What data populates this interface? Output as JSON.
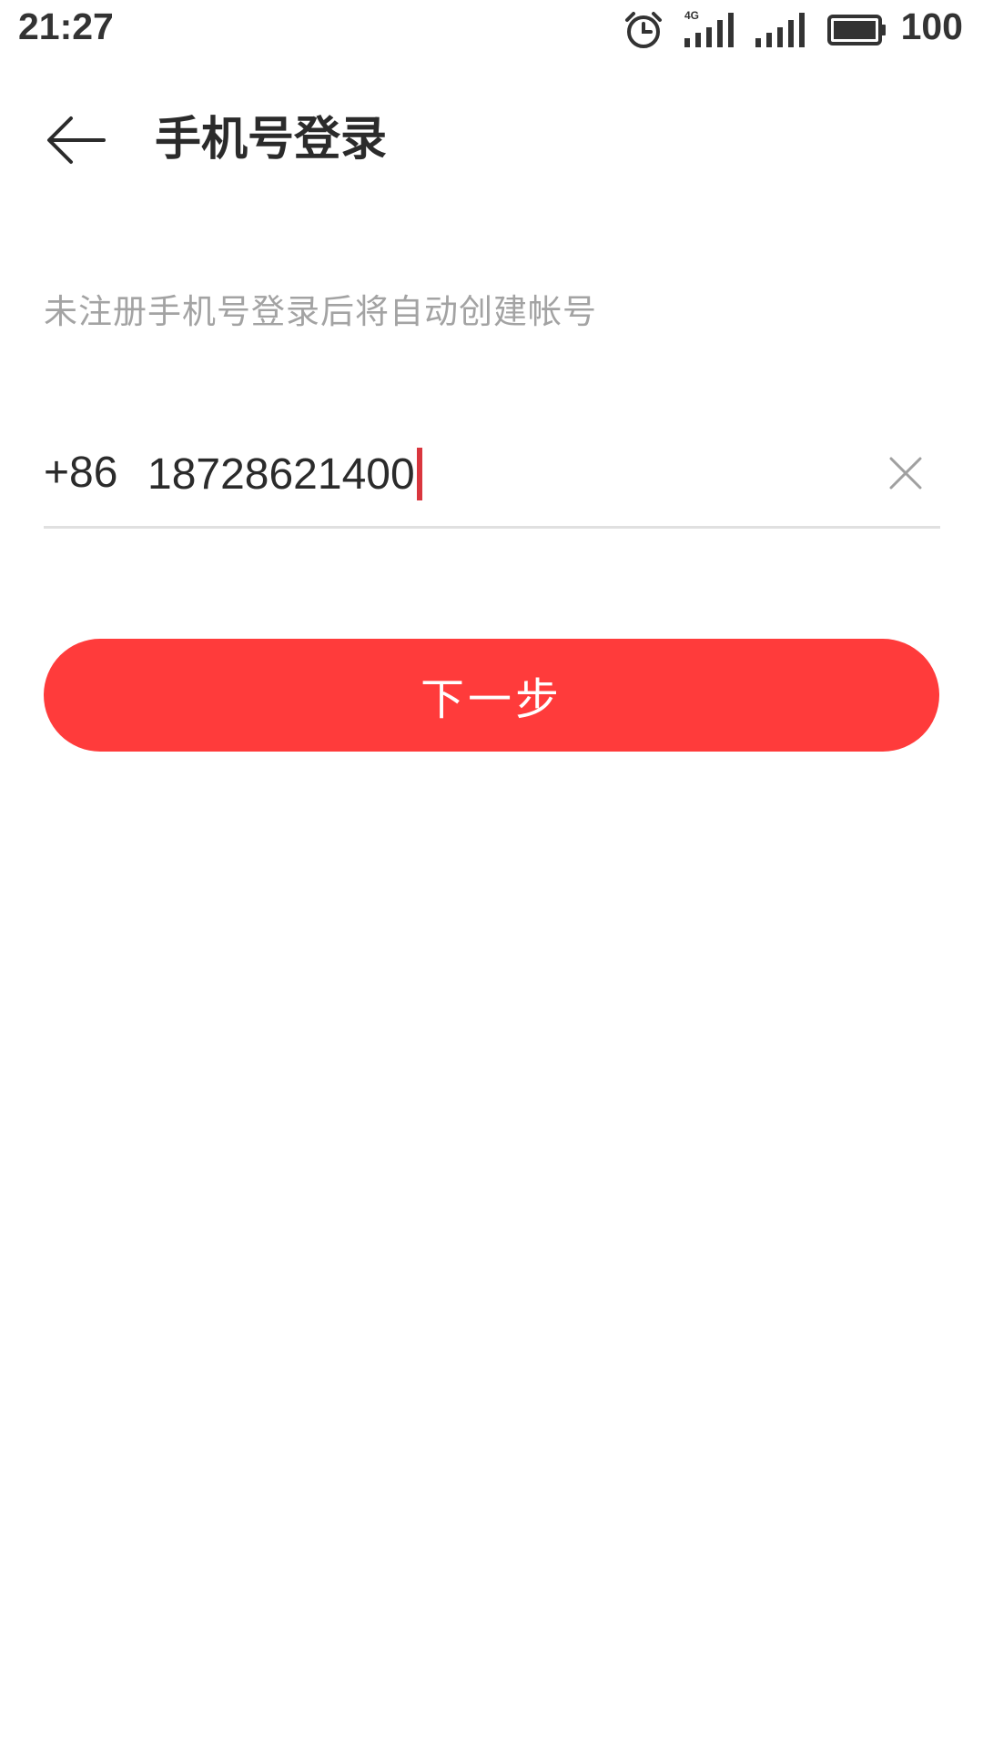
{
  "status_bar": {
    "time": "21:27",
    "network_label": "4G",
    "battery": "100",
    "icons": [
      "alarm-icon",
      "signal-4g-icon",
      "signal-icon",
      "battery-icon"
    ]
  },
  "header": {
    "back_icon": "back-arrow-icon",
    "title": "手机号登录"
  },
  "form": {
    "hint": "未注册手机号登录后将自动创建帐号",
    "country_code": "+86",
    "phone_value": "18728621400",
    "clear_icon": "close-icon",
    "caret_color": "#d9363e"
  },
  "actions": {
    "next_label": "下一步",
    "next_color": "#ff3b3b"
  }
}
